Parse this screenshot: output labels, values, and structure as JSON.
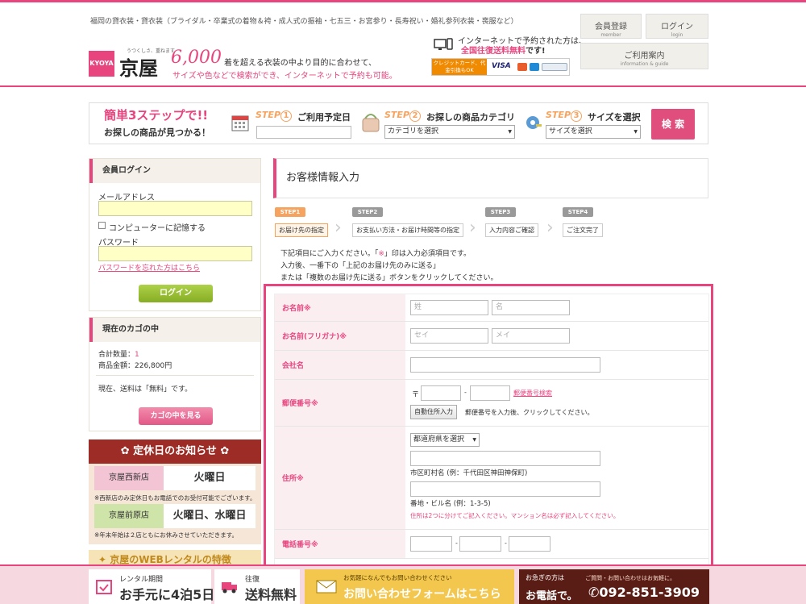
{
  "header": {
    "tagline": "福岡の貸衣装・貸衣装（ブライダル・卒業式の着物＆袴・成人式の振袖・七五三・お宮参り・長寿祝い・婚礼参列衣装・喪服など）",
    "logo": "KYOYA",
    "brand_sub": "うつくしさ、重ねます",
    "brand": "京屋",
    "count": "6,000",
    "slogan1": "着を超える衣装の中より目的に合わせて、",
    "slogan2": "サイズや色などで検索ができ、インターネットで予約も可能。",
    "net_text1": "インターネットで予約された方は、",
    "net_text2_pre": "全国往復送料無料",
    "net_text2_post": "です!",
    "card_badge": "クレジットカード、代金引換もOK",
    "visa": "VISA",
    "buttons": {
      "member": {
        "main": "会員登録",
        "sub": "member"
      },
      "login": {
        "main": "ログイン",
        "sub": "login"
      },
      "guide": {
        "main": "ご利用案内",
        "sub": "information & guide"
      }
    }
  },
  "search": {
    "title1": "簡単3ステップで!!",
    "title2": "お探しの商品が見つかる！",
    "step1_num": "1",
    "step1": "ご利用予定日",
    "step2_num": "2",
    "step2": "お探しの商品カテゴリ",
    "step3_num": "3",
    "step3": "サイズを選択",
    "step_word": "STEP",
    "category_value": "カテゴリを選択",
    "size_value": "サイズを選択",
    "submit": "検 索"
  },
  "sidebar": {
    "login": {
      "title": "会員ログイン",
      "email_label": "メールアドレス",
      "remember": "コンピューターに記憶する",
      "password_label": "パスワード",
      "forgot": "パスワードを忘れた方はこちら",
      "button": "ログイン"
    },
    "cart": {
      "title": "現在のカゴの中",
      "count_label": "合計数量：",
      "count": "1",
      "amount": "商品金額：226,800円",
      "shipping": "現在、送料は「無料」です。",
      "button": "カゴの中を見る"
    },
    "holiday": {
      "title": "定休日のお知らせ",
      "shops": [
        {
          "name": "京屋西新店",
          "day": "火曜日"
        },
        {
          "name": "京屋前原店",
          "day": "火曜日、水曜日"
        }
      ],
      "note1": "※西新店のみ定休日もお電話でのお受付可能でございます。",
      "note2": "※年末年始は２店ともにお休みさせていただきます。"
    },
    "feature": "京屋のWEBレンタルの特徴"
  },
  "main": {
    "title": "お客様情報入力",
    "steps": [
      {
        "tag": "STEP1",
        "name": "お届け先の指定"
      },
      {
        "tag": "STEP2",
        "name": "お支払い方法・お届け時間等の指定"
      },
      {
        "tag": "STEP3",
        "name": "入力内容ご確認"
      },
      {
        "tag": "STEP4",
        "name": "ご注文完了"
      }
    ],
    "intro1_pre": "下記項目にご入力ください。「",
    "intro1_req": "※",
    "intro1_post": "」印は入力必須項目です。",
    "intro2": "入力後、一番下の「上記のお届け先のみに送る」",
    "intro3": "または「複数のお届け先に送る」ボタンをクリックしてください。",
    "form": {
      "name_label": "お名前※",
      "last_ph": "姓",
      "first_ph": "名",
      "kana_label": "お名前(フリガナ)※",
      "last_kana_ph": "セイ",
      "first_kana_ph": "メイ",
      "company_label": "会社名",
      "zip_label": "郵便番号※",
      "zip_mark": "〒",
      "zip_dash": "-",
      "zip_search": "郵便番号検索",
      "auto_btn": "自動住所入力",
      "auto_hint": "郵便番号を入力後、クリックしてください。",
      "address_label": "住所※",
      "pref_value": "都道府県を選択",
      "city_hint": "市区町村名 (例：千代田区神田神保町)",
      "street_hint": "番地・ビル名 (例：1-3-5)",
      "address_note": "住所は2つに分けてご記入ください。マンション名は必ず記入してください。",
      "phone_label": "電話番号※",
      "phone_dash": "-"
    }
  },
  "footer": {
    "rental": {
      "top": "レンタル期間",
      "main": "お手元に4泊5日"
    },
    "shipping": {
      "top": "往復",
      "main": "送料無料"
    },
    "contact": {
      "top": "お気軽になんでもお問い合わせください",
      "main": "お問い合わせフォームはこちら"
    },
    "phone": {
      "top": "お急ぎの方は",
      "top2": "ご質問・お問い合わせはお気軽に。",
      "pre": "お電話で。",
      "number": "092-851-3909"
    }
  },
  "colors": {
    "accent": "#e8457f",
    "green": "#8db42b",
    "holiday": "#9c2c25",
    "orange": "#f6a35f"
  }
}
